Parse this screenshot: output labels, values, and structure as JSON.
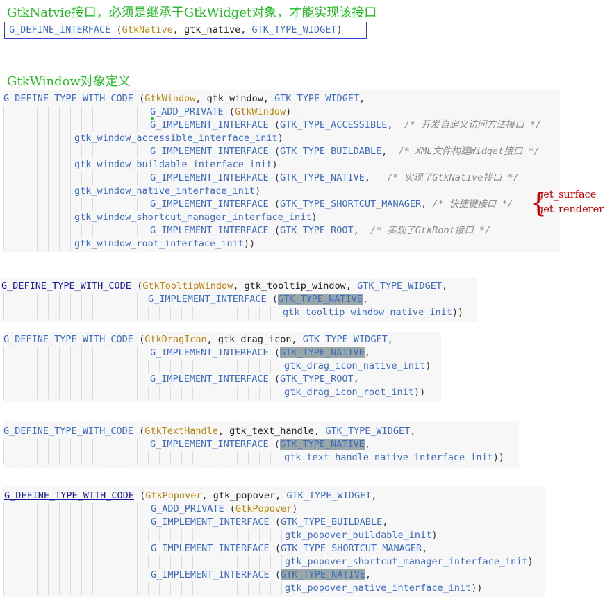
{
  "headings": {
    "native": "GtkNatvie接口，必须是继承于GtkWidget对象，才能实现该接口",
    "window": "GtkWindow对象定义"
  },
  "interface_decl": {
    "macro": "G_DEFINE_INTERFACE",
    "open": " (",
    "type": "GtkNative",
    "rest": ", gtk_native, ",
    "parent": "GTK_TYPE_WIDGET",
    "close": ")"
  },
  "window_block": {
    "macro": "G_DEFINE_TYPE_WITH_CODE",
    "type": "GtkWindow",
    "name": ", gtk_window, ",
    "parent": "GTK_TYPE_WIDGET",
    "add_private": "G_ADD_PRIVATE",
    "implement": "G_IMPLEMENT_INTERFACE",
    "accessible": "GTK_TYPE_ACCESSIBLE",
    "accessible_comment": "/* 开发自定义访问方法接口 */",
    "accessible_init": "gtk_window_accessible_interface_init",
    "buildable": "GTK_TYPE_BUILDABLE",
    "buildable_comment": "/* XML文件构建Widget接口 */",
    "buildable_init": "gtk_window_buildable_interface_init",
    "native": "GTK_TYPE_NATIVE",
    "native_comment": "/* 实现了GtkNative接口 */",
    "native_init": "gtk_window_native_interface_init",
    "shortcut": "GTK_TYPE_SHORTCUT_MANAGER",
    "shortcut_comment": "/* 快捷键接口 */",
    "shortcut_init": "gtk_window_shortcut_manager_interface_init",
    "root": "GTK_TYPE_ROOT",
    "root_comment": "/* 实现了GtkRoot接口 */",
    "root_init": "gtk_window_root_interface_init"
  },
  "native_notes": [
    "get_surface",
    "get_renderer"
  ],
  "tooltip_block": {
    "macro": "G_DEFINE_TYPE_WITH_CODE",
    "type": "GtkTooltipWindow",
    "name": ", gtk_tooltip_window, ",
    "parent": "GTK_TYPE_WIDGET",
    "implement": "G_IMPLEMENT_INTERFACE",
    "native": "GTK_TYPE_NATIVE",
    "native_init": "gtk_tooltip_window_native_init"
  },
  "dragicon_block": {
    "macro": "G_DEFINE_TYPE_WITH_CODE",
    "type": "GtkDragIcon",
    "name": ", gtk_drag_icon, ",
    "parent": "GTK_TYPE_WIDGET",
    "implement": "G_IMPLEMENT_INTERFACE",
    "native": "GTK_TYPE_NATIVE",
    "native_init": "gtk_drag_icon_native_init",
    "root": "GTK_TYPE_ROOT",
    "root_init": "gtk_drag_icon_root_init"
  },
  "texthandle_block": {
    "macro": "G_DEFINE_TYPE_WITH_CODE",
    "type": "GtkTextHandle",
    "name": ", gtk_text_handle, ",
    "parent": "GTK_TYPE_WIDGET",
    "implement": "G_IMPLEMENT_INTERFACE",
    "native": "GTK_TYPE_NATIVE",
    "native_init": "gtk_text_handle_native_interface_init"
  },
  "popover_block": {
    "macro": "G_DEFINE_TYPE_WITH_CODE",
    "type": "GtkPopover",
    "name": ", gtk_popover, ",
    "parent": "GTK_TYPE_WIDGET",
    "add_private": "G_ADD_PRIVATE",
    "implement": "G_IMPLEMENT_INTERFACE",
    "buildable": "GTK_TYPE_BUILDABLE",
    "buildable_init": "gtk_popover_buildable_init",
    "shortcut": "GTK_TYPE_SHORTCUT_MANAGER",
    "shortcut_init": "gtk_popover_shortcut_manager_interface_init",
    "native": "GTK_TYPE_NATIVE",
    "native_init": "gtk_popover_native_interface_init"
  },
  "punct": {
    "open": " (",
    "close": ")",
    "close2": "))",
    "comma": ",",
    "comma_sp": ", "
  }
}
